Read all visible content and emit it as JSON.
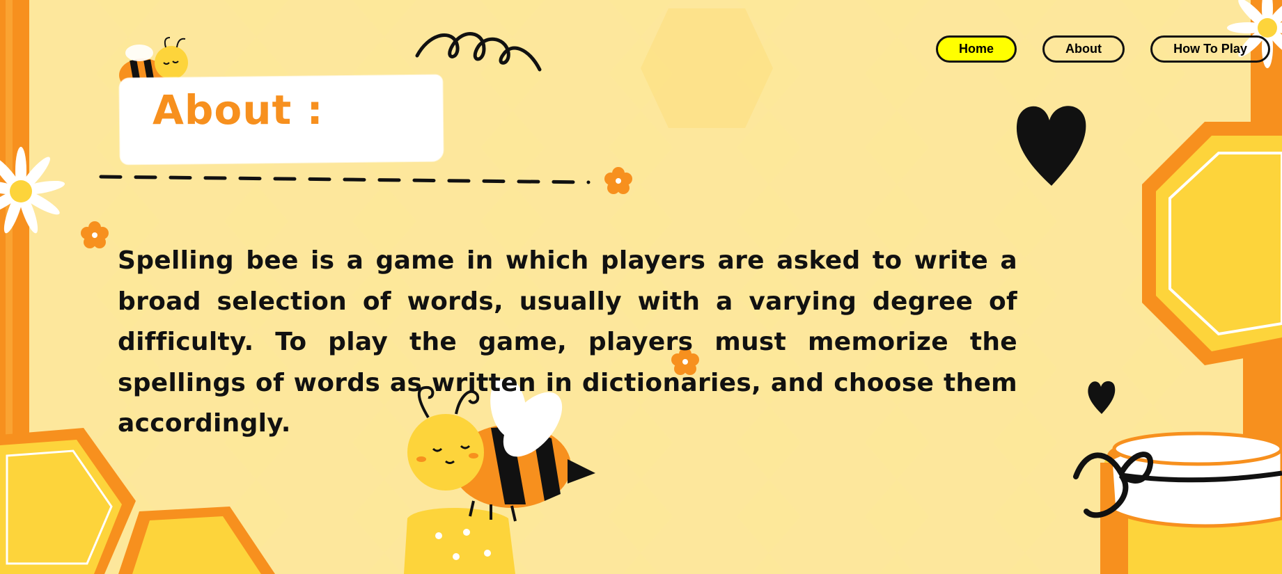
{
  "nav": {
    "home_label": "Home",
    "about_label": "About",
    "howto_label": "How To Play",
    "active": "Home"
  },
  "page": {
    "title": "About :",
    "description": "Spelling bee is a game in which players are asked to write a broad selection of words, usually with a varying degree of difficulty. To play the game, players must memorize the spellings of words as written in dictionaries, and choose them accordingly."
  },
  "colors": {
    "background": "#fde89a",
    "accent_orange": "#f7901e",
    "honey_yellow": "#fdd43b",
    "active_button": "#ffff00"
  },
  "icons": [
    "bee-icon",
    "flower-icon",
    "daisy-icon",
    "heart-icon",
    "honeycomb-icon",
    "honey-jar-icon",
    "squiggle-icon"
  ]
}
